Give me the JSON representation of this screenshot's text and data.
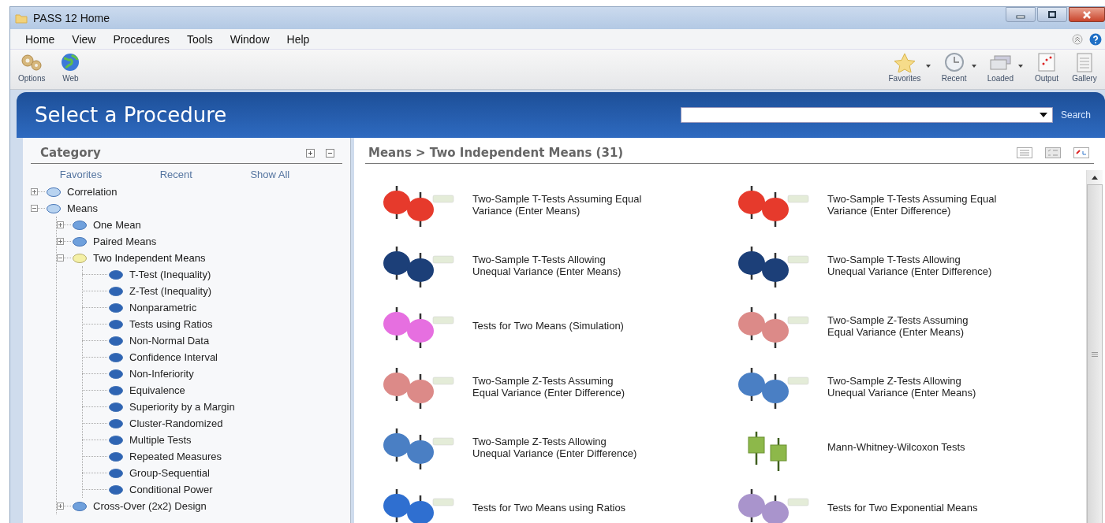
{
  "window": {
    "title": "PASS 12 Home"
  },
  "menu": [
    "Home",
    "View",
    "Procedures",
    "Tools",
    "Window",
    "Help"
  ],
  "toolbar_left": [
    {
      "label": "Options",
      "dropdown": false
    },
    {
      "label": "Web",
      "dropdown": false
    }
  ],
  "toolbar_right": [
    {
      "label": "Favorites",
      "dropdown": true
    },
    {
      "label": "Recent",
      "dropdown": true
    },
    {
      "label": "Loaded",
      "dropdown": true
    },
    {
      "label": "Output",
      "dropdown": false
    },
    {
      "label": "Gallery",
      "dropdown": false
    }
  ],
  "header": {
    "title": "Select a Procedure",
    "search_button": "Search"
  },
  "category": {
    "title": "Category",
    "links": [
      "Favorites",
      "Recent",
      "Show All"
    ],
    "tree": [
      {
        "label": "Correlation",
        "expanded": false,
        "selected": false
      },
      {
        "label": "Means",
        "expanded": true,
        "selected": false,
        "children": [
          {
            "label": "One Mean",
            "expanded": false,
            "selected": false
          },
          {
            "label": "Paired Means",
            "expanded": false,
            "selected": false
          },
          {
            "label": "Two Independent Means",
            "expanded": true,
            "selected": true,
            "children": [
              {
                "label": "T-Test (Inequality)",
                "selected": false
              },
              {
                "label": "Z-Test (Inequality)",
                "selected": false
              },
              {
                "label": "Nonparametric",
                "selected": false
              },
              {
                "label": "Tests using Ratios",
                "selected": false
              },
              {
                "label": "Non-Normal Data",
                "selected": false
              },
              {
                "label": "Confidence Interval",
                "selected": false
              },
              {
                "label": "Non-Inferiority",
                "selected": false
              },
              {
                "label": "Equivalence",
                "selected": false
              },
              {
                "label": "Superiority by a Margin",
                "selected": false
              },
              {
                "label": "Cluster-Randomized",
                "selected": false
              },
              {
                "label": "Multiple Tests",
                "selected": false
              },
              {
                "label": "Repeated Measures",
                "selected": false
              },
              {
                "label": "Group-Sequential",
                "selected": false
              },
              {
                "label": "Conditional Power",
                "selected": false
              }
            ]
          },
          {
            "label": "Cross-Over (2x2) Design",
            "expanded": false,
            "selected": false
          }
        ]
      }
    ]
  },
  "results": {
    "title": "Means > Two Independent Means (31)",
    "procedures": [
      {
        "title": "Two-Sample T-Tests Assuming Equal Variance (Enter Means)",
        "color": "#e63a2c",
        "kind": "circles"
      },
      {
        "title": "Two-Sample T-Tests Assuming Equal Variance (Enter Difference)",
        "color": "#e63a2c",
        "kind": "circles"
      },
      {
        "title": "Two-Sample T-Tests Allowing Unequal Variance (Enter Means)",
        "color": "#1c3f78",
        "kind": "circles"
      },
      {
        "title": "Two-Sample T-Tests Allowing Unequal Variance (Enter Difference)",
        "color": "#1c3f78",
        "kind": "circles"
      },
      {
        "title": "Tests for Two Means (Simulation)",
        "color": "#e66fe0",
        "kind": "circles"
      },
      {
        "title": "Two-Sample Z-Tests Assuming Equal Variance (Enter Means)",
        "color": "#dc8a88",
        "kind": "circles"
      },
      {
        "title": "Two-Sample Z-Tests Assuming Equal Variance (Enter Difference)",
        "color": "#dc8a88",
        "kind": "circles"
      },
      {
        "title": "Two-Sample Z-Tests Allowing Unequal Variance (Enter Means)",
        "color": "#4a7fc4",
        "kind": "circles"
      },
      {
        "title": "Two-Sample Z-Tests Allowing Unequal Variance (Enter Difference)",
        "color": "#4a7fc4",
        "kind": "circles"
      },
      {
        "title": "Mann-Whitney-Wilcoxon Tests",
        "color": "#8db84a",
        "kind": "squares"
      },
      {
        "title": "Tests for Two Means using Ratios",
        "color": "#2f6fd0",
        "kind": "circles"
      },
      {
        "title": "Tests for Two Exponential Means",
        "color": "#a994cc",
        "kind": "circles"
      }
    ]
  }
}
